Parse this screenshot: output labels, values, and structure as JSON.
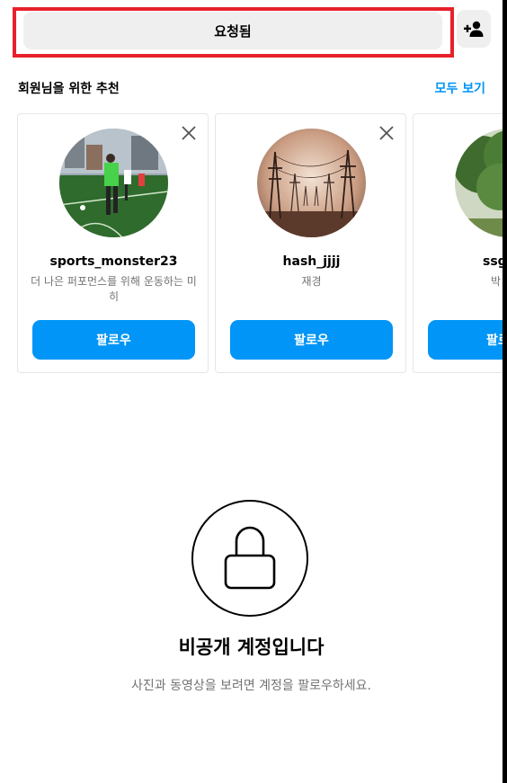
{
  "top_bar": {
    "requested_label": "요청됨",
    "add_user_icon": "add-user-icon"
  },
  "suggestions": {
    "title": "회원님을 위한 추천",
    "see_all": "모두 보기",
    "cards": [
      {
        "username": "sports_monster23",
        "subtitle": "더 나은 퍼포먼스를 위해 운동하는 미히",
        "follow_label": "팔로우",
        "avatar": "soccer-players-photo"
      },
      {
        "username": "hash_jjjj",
        "subtitle": "재경",
        "follow_label": "팔로우",
        "avatar": "power-lines-photo"
      },
      {
        "username": "ssg",
        "subtitle": "박",
        "follow_label": "팔로",
        "avatar": "tree-photo"
      }
    ]
  },
  "private_account": {
    "title": "비공개 계정입니다",
    "subtitle": "사진과 동영상을 보려면 계정을 팔로우하세요.",
    "icon": "lock-icon"
  },
  "colors": {
    "accent": "#0095f6",
    "highlight": "#e8202a",
    "button_gray": "#efefef",
    "muted_text": "#737373"
  }
}
